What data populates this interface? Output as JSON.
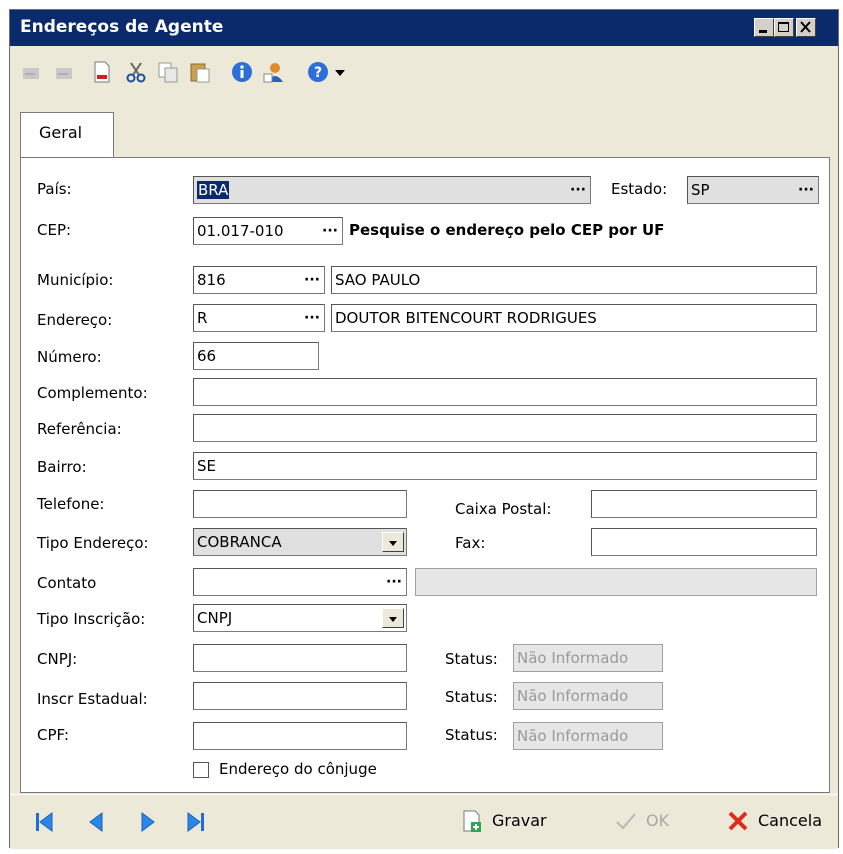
{
  "window": {
    "title": "Endereços de Agente"
  },
  "toolbar": {
    "icons": [
      "edit-prev-icon",
      "edit-next-icon",
      "new-document-icon",
      "cut-icon",
      "copy-icon",
      "paste-icon",
      "info-icon",
      "user-icon",
      "help-icon",
      "dropdown-arrow-icon"
    ]
  },
  "tabs": [
    {
      "label": "Geral"
    }
  ],
  "form": {
    "pais_label": "País:",
    "pais_value": "BRA",
    "estado_label": "Estado:",
    "estado_value": "SP",
    "cep_label": "CEP:",
    "cep_value": "01.017-010",
    "cep_search_text": "Pesquise o endereço pelo CEP por UF",
    "municipio_label": "Município:",
    "municipio_code": "816",
    "municipio_name": "SAO PAULO",
    "endereco_label": "Endereço:",
    "endereco_type": "R",
    "endereco_name": "DOUTOR BITENCOURT RODRIGUES",
    "numero_label": "Número:",
    "numero_value": "66",
    "complemento_label": "Complemento:",
    "complemento_value": "",
    "referencia_label": "Referência:",
    "referencia_value": "",
    "bairro_label": "Bairro:",
    "bairro_value": "SE",
    "telefone_label": "Telefone:",
    "telefone_value": "",
    "caixa_postal_label": "Caixa Postal:",
    "caixa_postal_value": "",
    "tipo_endereco_label": "Tipo Endereço:",
    "tipo_endereco_value": "COBRANCA",
    "fax_label": "Fax:",
    "fax_value": "",
    "contato_label": "Contato",
    "contato_value": "",
    "tipo_inscricao_label": "Tipo Inscrição:",
    "tipo_inscricao_value": "CNPJ",
    "cnpj_label": "CNPJ:",
    "cnpj_value": "",
    "inscr_estadual_label": "Inscr Estadual:",
    "inscr_estadual_value": "",
    "cpf_label": "CPF:",
    "cpf_value": " .  .  -",
    "status_label": "Status:",
    "status_cnpj": "Não Informado",
    "status_ie": "Não Informado",
    "status_cpf": "Não Informado",
    "conjuge_label": "Endereço do cônjuge",
    "conjuge_checked": false
  },
  "footer": {
    "gravar": "Gravar",
    "ok": "OK",
    "cancela": "Cancela"
  },
  "colors": {
    "titlebar": "#0a2a6b",
    "chrome": "#ece9d8",
    "field_gray": "#e0e0e0"
  }
}
